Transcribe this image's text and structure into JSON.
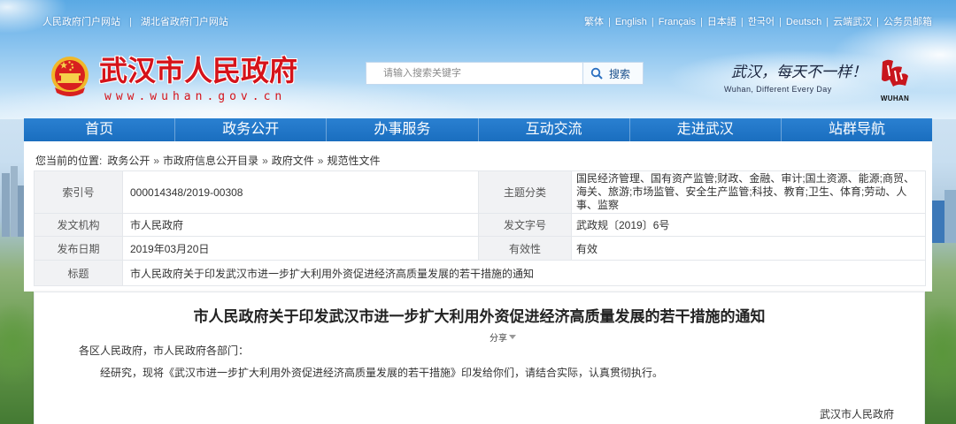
{
  "top_bar": {
    "left_links": [
      "人民政府门户网站",
      "湖北省政府门户网站"
    ],
    "right_links": [
      "繁体",
      "English",
      "Français",
      "日本語",
      "한국어",
      "Deutsch",
      "云端武汉",
      "公务员邮箱"
    ],
    "separator": "|"
  },
  "header": {
    "site_title": "武汉市人民政府",
    "site_url": "www.wuhan.gov.cn",
    "search": {
      "placeholder": "请输入搜索关键字",
      "value": "",
      "button_label": "搜索"
    },
    "slogan_cn": "武汉，每天不一样！",
    "slogan_en": "Wuhan, Different Every Day",
    "logo_text": "WUHAN"
  },
  "nav": {
    "items": [
      "首页",
      "政务公开",
      "办事服务",
      "互动交流",
      "走进武汉",
      "站群导航"
    ]
  },
  "breadcrumb": {
    "label": "您当前的位置:",
    "items": [
      "政务公开",
      "市政府信息公开目录",
      "政府文件",
      "规范性文件"
    ],
    "separator": "»"
  },
  "doc_info": {
    "index_no": {
      "label": "索引号",
      "value": "000014348/2019-00308"
    },
    "topic": {
      "label": "主题分类",
      "value": "国民经济管理、国有资产监管;财政、金融、审计;国土资源、能源;商贸、海关、旅游;市场监管、安全生产监管;科技、教育;卫生、体育;劳动、人事、监察"
    },
    "issuer": {
      "label": "发文机构",
      "value": "市人民政府"
    },
    "doc_no": {
      "label": "发文字号",
      "value": "武政规〔2019〕6号"
    },
    "publish_date": {
      "label": "发布日期",
      "value": "2019年03月20日"
    },
    "validity": {
      "label": "有效性",
      "value": "有效"
    },
    "title": {
      "label": "标题",
      "value": "市人民政府关于印发武汉市进一步扩大利用外资促进经济高质量发展的若干措施的通知"
    }
  },
  "article": {
    "title": "市人民政府关于印发武汉市进一步扩大利用外资促进经济高质量发展的若干措施的通知",
    "share_label": "分享",
    "salutation": "各区人民政府，市人民政府各部门：",
    "body": "经研究，现将《武汉市进一步扩大利用外资促进经济高质量发展的若干措施》印发给你们，请结合实际，认真贯彻执行。",
    "signature": "武汉市人民政府"
  },
  "icons": {
    "emblem": "national-emblem-icon",
    "search": "search-icon",
    "share_dropdown": "chevron-down-icon",
    "city_logo": "wuhan-city-logo"
  },
  "colors": {
    "nav_background": "#1e72c6",
    "site_title": "#d5131a",
    "label_cell_background": "#f1f2f4",
    "page_text": "#333333"
  }
}
